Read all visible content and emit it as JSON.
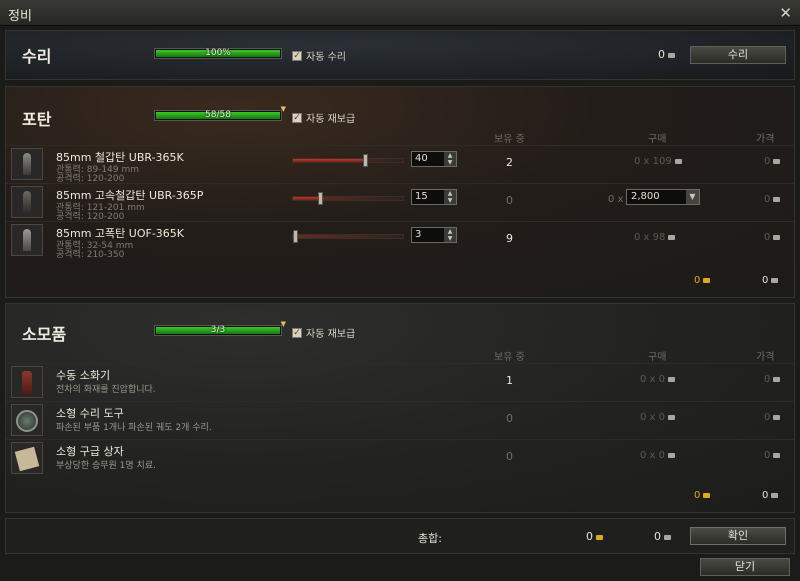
{
  "window": {
    "title": "정비",
    "close_glyph": "✕"
  },
  "repair": {
    "title": "수리",
    "progress_text": "100%",
    "progress_fraction": 1.0,
    "auto_label": "자동 수리",
    "auto_checked": true,
    "cost": "0",
    "button_label": "수리"
  },
  "shells": {
    "title": "포탄",
    "progress_text": "58/58",
    "progress_fraction": 1.0,
    "auto_label": "자동 재보급",
    "auto_checked": true,
    "col_owned": "보유 중",
    "col_buy": "구매",
    "col_price": "가격",
    "items": [
      {
        "name": "85mm 철갑탄 UBR-365K",
        "line1": "관통력: 89-149 mm",
        "line2": "공격력: 120-200",
        "qty": "40",
        "slider_fraction": 0.66,
        "owned": "2",
        "owned_dim": false,
        "buy": "0 x 109",
        "price": "0",
        "tip_color": "#c0392b"
      },
      {
        "name": "85mm 고속철갑탄 UBR-365P",
        "line1": "관통력: 121-201 mm",
        "line2": "공격력: 120-200",
        "qty": "15",
        "slider_fraction": 0.25,
        "owned": "0",
        "owned_dim": true,
        "buy_prefix": "0 x",
        "buy_select": "2,800",
        "price": "0",
        "tip_color": "#5a5a56"
      },
      {
        "name": "85mm 고폭탄 UOF-365K",
        "line1": "관통력: 32-54 mm",
        "line2": "공격력: 210-350",
        "qty": "3",
        "slider_fraction": 0.03,
        "owned": "9",
        "owned_dim": false,
        "buy": "0 x 98",
        "price": "0",
        "tip_color": "#c0392b"
      }
    ],
    "subtotal_gold": "0",
    "subtotal_credits": "0"
  },
  "consumables": {
    "title": "소모품",
    "progress_text": "3/3",
    "progress_fraction": 1.0,
    "auto_label": "자동 재보급",
    "auto_checked": true,
    "col_owned": "보유 중",
    "col_buy": "구매",
    "col_price": "가격",
    "items": [
      {
        "name": "수동 소화기",
        "desc": "전차의 화재를 진압합니다.",
        "owned": "1",
        "owned_dim": false,
        "buy": "0 x 0",
        "price": "0"
      },
      {
        "name": "소형 수리 도구",
        "desc": "파손된 부품 1개나 파손된 궤도 2개 수리.",
        "owned": "0",
        "owned_dim": true,
        "buy": "0 x 0",
        "price": "0"
      },
      {
        "name": "소형 구급 상자",
        "desc": "부상당한 승무원 1명 치료.",
        "owned": "0",
        "owned_dim": true,
        "buy": "0 x 0",
        "price": "0"
      }
    ],
    "subtotal_gold": "0",
    "subtotal_credits": "0"
  },
  "footer": {
    "total_label": "총합:",
    "total_gold": "0",
    "total_credits": "0",
    "confirm_label": "확인",
    "close_label": "닫기"
  }
}
